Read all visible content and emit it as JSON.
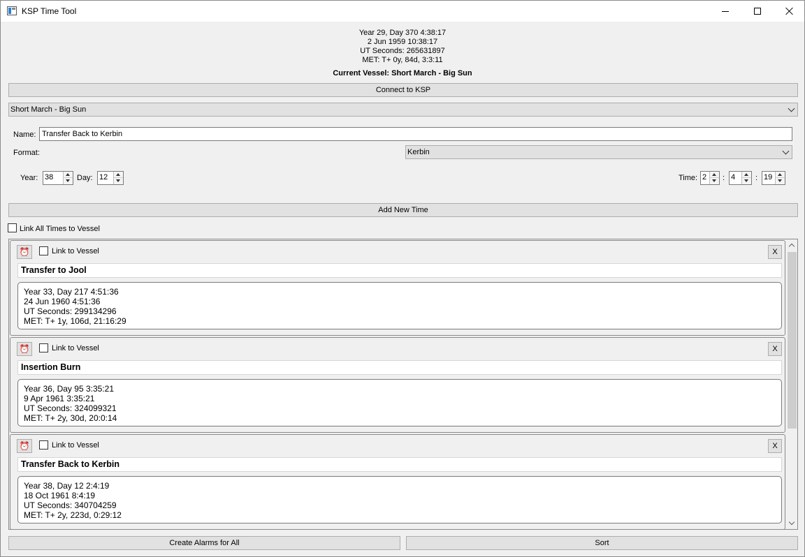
{
  "window": {
    "title": "KSP Time Tool"
  },
  "header": {
    "kerbin_time": "Year 29, Day 370 4:38:17",
    "earth_time": "2 Jun 1959 10:38:17",
    "ut_seconds": "UT Seconds: 265631897",
    "met": "MET: T+ 0y, 84d, 3:3:11",
    "current_vessel": "Current Vessel: Short March - Big Sun"
  },
  "connect_button": "Connect to KSP",
  "vessel_select": {
    "selected": "Short March - Big Sun"
  },
  "form": {
    "name_label": "Name:",
    "name_value": "Transfer Back to Kerbin",
    "format_label": "Format:",
    "format_selected": "Kerbin",
    "year_label": "Year:",
    "year_value": "38",
    "day_label": "Day:",
    "day_value": "12",
    "time_label": "Time:",
    "hour_value": "2",
    "minute_value": "4",
    "second_value": "19",
    "separator": ":"
  },
  "add_button": "Add New Time",
  "link_all_label": "Link All Times to Vessel",
  "entries": [
    {
      "link_label": "Link to Vessel",
      "remove_label": "X",
      "name": "Transfer to Jool",
      "lines": [
        "Year 33, Day 217 4:51:36",
        "24 Jun 1960 4:51:36",
        "UT Seconds: 299134296",
        "MET: T+ 1y, 106d, 21:16:29"
      ]
    },
    {
      "link_label": "Link to Vessel",
      "remove_label": "X",
      "name": "Insertion Burn",
      "lines": [
        "Year 36, Day 95 3:35:21",
        "9 Apr 1961 3:35:21",
        "UT Seconds: 324099321",
        "MET: T+ 2y, 30d, 20:0:14"
      ]
    },
    {
      "link_label": "Link to Vessel",
      "remove_label": "X",
      "name": "Transfer Back to Kerbin",
      "lines": [
        "Year 38, Day 12 2:4:19",
        "18 Oct 1961 8:4:19",
        "UT Seconds: 340704259",
        "MET: T+ 2y, 223d, 0:29:12"
      ]
    }
  ],
  "footer": {
    "create_alarms": "Create Alarms for All",
    "sort": "Sort"
  },
  "icons": {
    "app": "app-window-icon",
    "alarm": "alarm-clock-icon"
  }
}
